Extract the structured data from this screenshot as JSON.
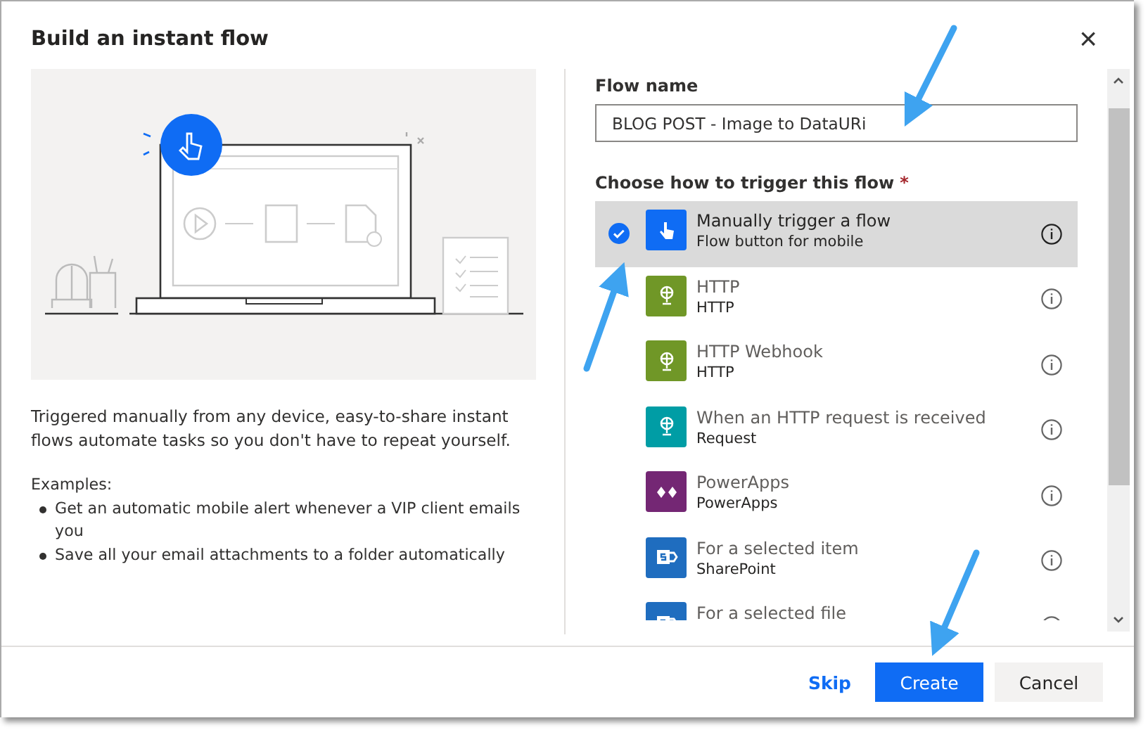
{
  "dialog": {
    "title": "Build an instant flow",
    "close": "×"
  },
  "description": "Triggered manually from any device, easy-to-share instant flows automate tasks so you don't have to repeat yourself.",
  "examples_label": "Examples:",
  "examples": [
    "Get an automatic mobile alert whenever a VIP client emails you",
    "Save all your email attachments to a folder automatically"
  ],
  "flow_name": {
    "label": "Flow name",
    "value": "BLOG POST - Image to DataURi"
  },
  "trigger_label": "Choose how to trigger this flow",
  "required_mark": "*",
  "triggers": [
    {
      "title": "Manually trigger a flow",
      "subtitle": "Flow button for mobile",
      "kind": "hand",
      "color": "#0f6cf4",
      "selected": true
    },
    {
      "title": "HTTP",
      "subtitle": "HTTP",
      "kind": "globe",
      "color": "#709727",
      "selected": false
    },
    {
      "title": "HTTP Webhook",
      "subtitle": "HTTP",
      "kind": "globe",
      "color": "#709727",
      "selected": false
    },
    {
      "title": "When an HTTP request is received",
      "subtitle": "Request",
      "kind": "globe",
      "color": "#009da5",
      "selected": false
    },
    {
      "title": "PowerApps",
      "subtitle": "PowerApps",
      "kind": "apps",
      "color": "#742774",
      "selected": false
    },
    {
      "title": "For a selected item",
      "subtitle": "SharePoint",
      "kind": "sharepoint",
      "color": "#1f6dbf",
      "selected": false
    },
    {
      "title": "For a selected file",
      "kind": "sharepoint",
      "color": "#1f6dbf",
      "selected": false
    }
  ],
  "buttons": [
    {
      "label": "Skip",
      "kind": "link"
    },
    {
      "label": "Create",
      "kind": "primary"
    },
    {
      "label": "Cancel",
      "kind": "secondary"
    }
  ]
}
